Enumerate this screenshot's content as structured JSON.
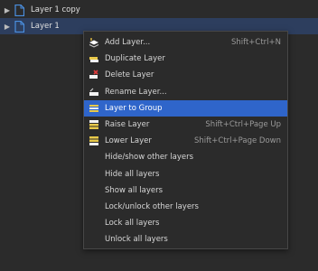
{
  "layers": [
    {
      "name": "Layer 1 copy",
      "selected": false
    },
    {
      "name": "Layer 1",
      "selected": true
    }
  ],
  "menu": {
    "items": [
      {
        "label": "Add Layer...",
        "shortcut": "Shift+Ctrl+N",
        "icon": "add-layer-icon"
      },
      {
        "label": "Duplicate Layer",
        "shortcut": "",
        "icon": "duplicate-layer-icon"
      },
      {
        "label": "Delete Layer",
        "shortcut": "",
        "icon": "delete-layer-icon"
      },
      {
        "label": "Rename Layer...",
        "shortcut": "",
        "icon": "rename-layer-icon"
      },
      {
        "label": "Layer to Group",
        "shortcut": "",
        "icon": "layer-to-group-icon",
        "highlight": true
      },
      {
        "label": "Raise Layer",
        "shortcut": "Shift+Ctrl+Page Up",
        "icon": "raise-layer-icon"
      },
      {
        "label": "Lower Layer",
        "shortcut": "Shift+Ctrl+Page Down",
        "icon": "lower-layer-icon"
      },
      {
        "label": "Hide/show other layers",
        "shortcut": ""
      },
      {
        "label": "Hide all layers",
        "shortcut": ""
      },
      {
        "label": "Show all layers",
        "shortcut": ""
      },
      {
        "label": "Lock/unlock other layers",
        "shortcut": ""
      },
      {
        "label": "Lock all layers",
        "shortcut": ""
      },
      {
        "label": "Unlock all layers",
        "shortcut": ""
      }
    ]
  },
  "colors": {
    "background": "#2b2b2b",
    "selected_row": "#2d3e5e",
    "menu_highlight": "#2f65ca",
    "file_icon": "#4a8fe0"
  }
}
